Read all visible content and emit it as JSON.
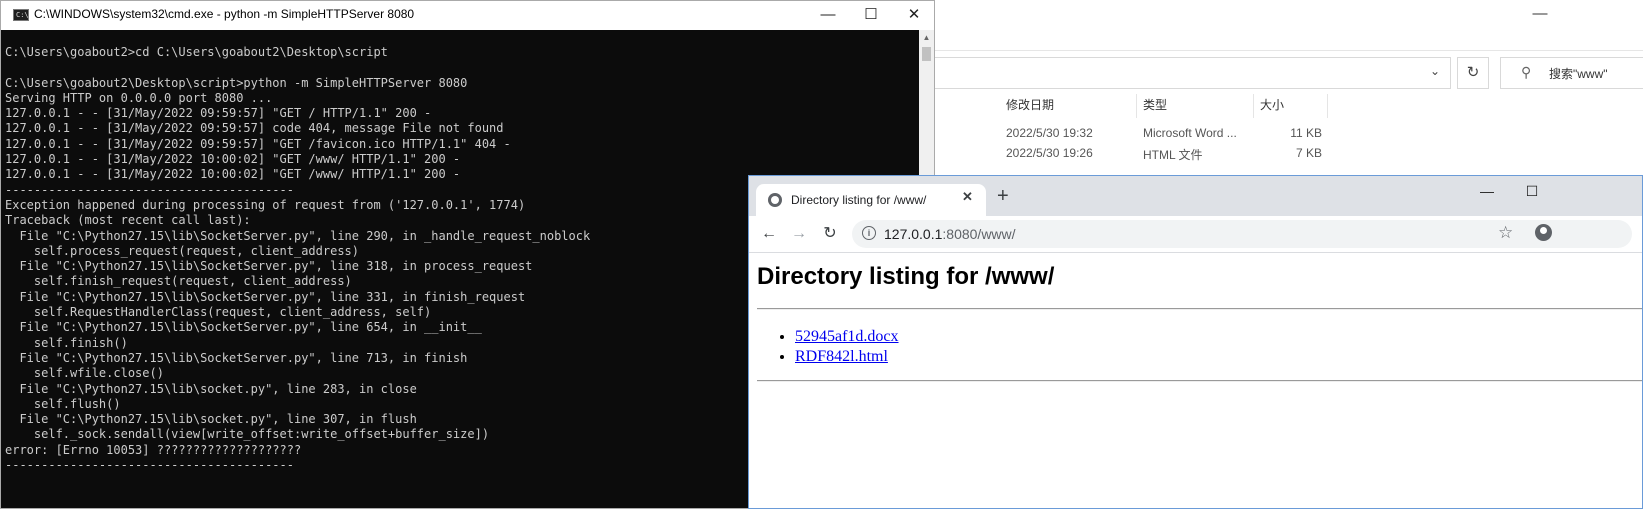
{
  "explorer": {
    "search_placeholder": "搜索\"www\"",
    "columns": [
      "修改日期",
      "类型",
      "大小"
    ],
    "rows": [
      {
        "date": "2022/5/30 19:32",
        "type": "Microsoft Word ...",
        "size": "11 KB"
      },
      {
        "date": "2022/5/30 19:26",
        "type": "HTML 文件",
        "size": "7 KB"
      }
    ]
  },
  "cmd": {
    "title": "C:\\WINDOWS\\system32\\cmd.exe - python  -m SimpleHTTPServer 8080",
    "lines": [
      "C:\\Users\\goabout2>cd C:\\Users\\goabout2\\Desktop\\script",
      "",
      "C:\\Users\\goabout2\\Desktop\\script>python -m SimpleHTTPServer 8080",
      "Serving HTTP on 0.0.0.0 port 8080 ...",
      "127.0.0.1 - - [31/May/2022 09:59:57] \"GET / HTTP/1.1\" 200 -",
      "127.0.0.1 - - [31/May/2022 09:59:57] code 404, message File not found",
      "127.0.0.1 - - [31/May/2022 09:59:57] \"GET /favicon.ico HTTP/1.1\" 404 -",
      "127.0.0.1 - - [31/May/2022 10:00:02] \"GET /www/ HTTP/1.1\" 200 -",
      "127.0.0.1 - - [31/May/2022 10:00:02] \"GET /www/ HTTP/1.1\" 200 -",
      "----------------------------------------",
      "Exception happened during processing of request from ('127.0.0.1', 1774)",
      "Traceback (most recent call last):",
      "  File \"C:\\Python27.15\\lib\\SocketServer.py\", line 290, in _handle_request_noblock",
      "    self.process_request(request, client_address)",
      "  File \"C:\\Python27.15\\lib\\SocketServer.py\", line 318, in process_request",
      "    self.finish_request(request, client_address)",
      "  File \"C:\\Python27.15\\lib\\SocketServer.py\", line 331, in finish_request",
      "    self.RequestHandlerClass(request, client_address, self)",
      "  File \"C:\\Python27.15\\lib\\SocketServer.py\", line 654, in __init__",
      "    self.finish()",
      "  File \"C:\\Python27.15\\lib\\SocketServer.py\", line 713, in finish",
      "    self.wfile.close()",
      "  File \"C:\\Python27.15\\lib\\socket.py\", line 283, in close",
      "    self.flush()",
      "  File \"C:\\Python27.15\\lib\\socket.py\", line 307, in flush",
      "    self._sock.sendall(view[write_offset:write_offset+buffer_size])",
      "error: [Errno 10053] ????????????????????",
      "----------------------------------------"
    ]
  },
  "browser": {
    "tab_title": "Directory listing for /www/",
    "url_host": "127.0.0.1",
    "url_path": ":8080/www/",
    "heading": "Directory listing for /www/",
    "files": [
      "52945af1d.docx",
      "RDF842l.html"
    ]
  }
}
